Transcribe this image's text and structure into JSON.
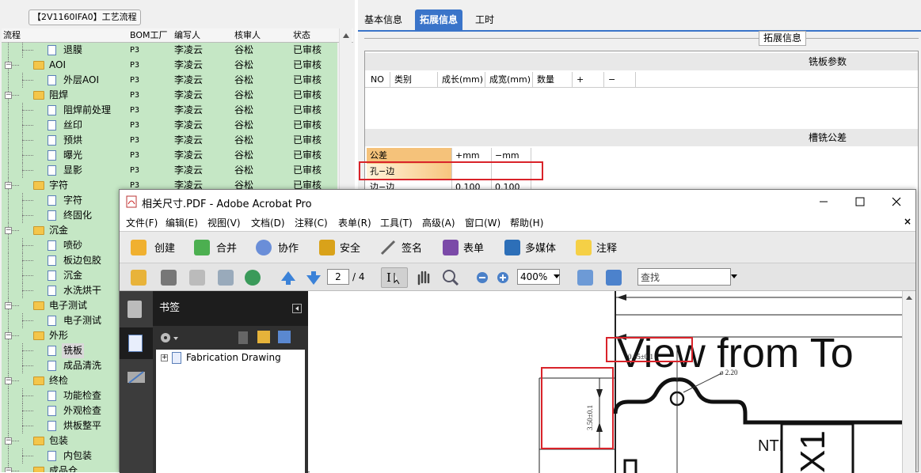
{
  "left_panel": {
    "title": "【2V1160IFA0】工艺流程",
    "columns": [
      "流程",
      "BOM工厂",
      "编写人",
      "核审人",
      "状态"
    ],
    "rows": [
      {
        "name": "退膜",
        "level": 2,
        "type": "doc",
        "bom": "P3",
        "writer": "李凌云",
        "reviewer": "谷松",
        "status": "已审核"
      },
      {
        "name": "AOI",
        "level": 1,
        "type": "folder",
        "bom": "P3",
        "writer": "李凌云",
        "reviewer": "谷松",
        "status": "已审核"
      },
      {
        "name": "外层AOI",
        "level": 2,
        "type": "doc",
        "bom": "P3",
        "writer": "李凌云",
        "reviewer": "谷松",
        "status": "已审核"
      },
      {
        "name": "阻焊",
        "level": 1,
        "type": "folder",
        "bom": "P3",
        "writer": "李凌云",
        "reviewer": "谷松",
        "status": "已审核"
      },
      {
        "name": "阻焊前处理",
        "level": 2,
        "type": "doc",
        "bom": "P3",
        "writer": "李凌云",
        "reviewer": "谷松",
        "status": "已审核"
      },
      {
        "name": "丝印",
        "level": 2,
        "type": "doc",
        "bom": "P3",
        "writer": "李凌云",
        "reviewer": "谷松",
        "status": "已审核"
      },
      {
        "name": "预烘",
        "level": 2,
        "type": "doc",
        "bom": "P3",
        "writer": "李凌云",
        "reviewer": "谷松",
        "status": "已审核"
      },
      {
        "name": "曝光",
        "level": 2,
        "type": "doc",
        "bom": "P3",
        "writer": "李凌云",
        "reviewer": "谷松",
        "status": "已审核"
      },
      {
        "name": "显影",
        "level": 2,
        "type": "doc",
        "bom": "P3",
        "writer": "李凌云",
        "reviewer": "谷松",
        "status": "已审核"
      },
      {
        "name": "字符",
        "level": 1,
        "type": "folder",
        "bom": "P3",
        "writer": "李凌云",
        "reviewer": "谷松",
        "status": "已审核"
      },
      {
        "name": "字符",
        "level": 2,
        "type": "doc"
      },
      {
        "name": "终固化",
        "level": 2,
        "type": "doc"
      },
      {
        "name": "沉金",
        "level": 1,
        "type": "folder"
      },
      {
        "name": "喷砂",
        "level": 2,
        "type": "doc"
      },
      {
        "name": "板边包胶",
        "level": 2,
        "type": "doc"
      },
      {
        "name": "沉金",
        "level": 2,
        "type": "doc"
      },
      {
        "name": "水洗烘干",
        "level": 2,
        "type": "doc"
      },
      {
        "name": "电子测试",
        "level": 1,
        "type": "folder"
      },
      {
        "name": "电子测试",
        "level": 2,
        "type": "doc"
      },
      {
        "name": "外形",
        "level": 1,
        "type": "folder"
      },
      {
        "name": "铣板",
        "level": 2,
        "type": "doc",
        "selected": true
      },
      {
        "name": "成品清洗",
        "level": 2,
        "type": "doc"
      },
      {
        "name": "终检",
        "level": 1,
        "type": "folder"
      },
      {
        "name": "功能检查",
        "level": 2,
        "type": "doc"
      },
      {
        "name": "外观检查",
        "level": 2,
        "type": "doc"
      },
      {
        "name": "烘板整平",
        "level": 2,
        "type": "doc"
      },
      {
        "name": "包装",
        "level": 1,
        "type": "folder"
      },
      {
        "name": "内包装",
        "level": 2,
        "type": "doc"
      },
      {
        "name": "成品仓",
        "level": 1,
        "type": "folder"
      }
    ]
  },
  "right_panel": {
    "tabs": [
      "基本信息",
      "拓展信息",
      "工时"
    ],
    "active_tab": "拓展信息",
    "section_label": "拓展信息",
    "milling_params": {
      "title": "铣板参数",
      "columns": [
        "NO",
        "类别",
        "成长(mm)",
        "成宽(mm)",
        "数量",
        "+",
        "−"
      ]
    },
    "slot_tolerance": {
      "title": "槽铣公差",
      "header": [
        "公差",
        "+mm",
        "−mm"
      ],
      "rows": [
        [
          "孔−边",
          "",
          ""
        ],
        [
          "边−边",
          "0.100",
          "0.100"
        ]
      ]
    }
  },
  "acrobat": {
    "title": "相关尺寸.PDF - Adobe Acrobat Pro",
    "menu": [
      "文件(F)",
      "编辑(E)",
      "视图(V)",
      "文档(D)",
      "注释(C)",
      "表单(R)",
      "工具(T)",
      "高级(A)",
      "窗口(W)",
      "帮助(H)"
    ],
    "toolbar1": [
      "创建",
      "合并",
      "协作",
      "安全",
      "签名",
      "表单",
      "多媒体",
      "注释"
    ],
    "page_current": "2",
    "page_total": "/ 4",
    "zoom": "400%",
    "search_placeholder": "查找",
    "bookmarks_title": "书签",
    "bookmark_item": "Fabrication Drawing",
    "drawing": {
      "heading": "View from To",
      "dim_horizontal": "0.65±0.1",
      "dim_vertical": "3.50±0.1",
      "hole_label": "ø 2.20",
      "label_nt": "NTH",
      "label_x": "X1"
    },
    "close_glyph": "×"
  },
  "colors": {
    "tree_bg": "#c5e7c5",
    "tab_active": "#3a74c9",
    "highlight_red": "#d9232a",
    "tolerance_header": "#f5c27a"
  }
}
